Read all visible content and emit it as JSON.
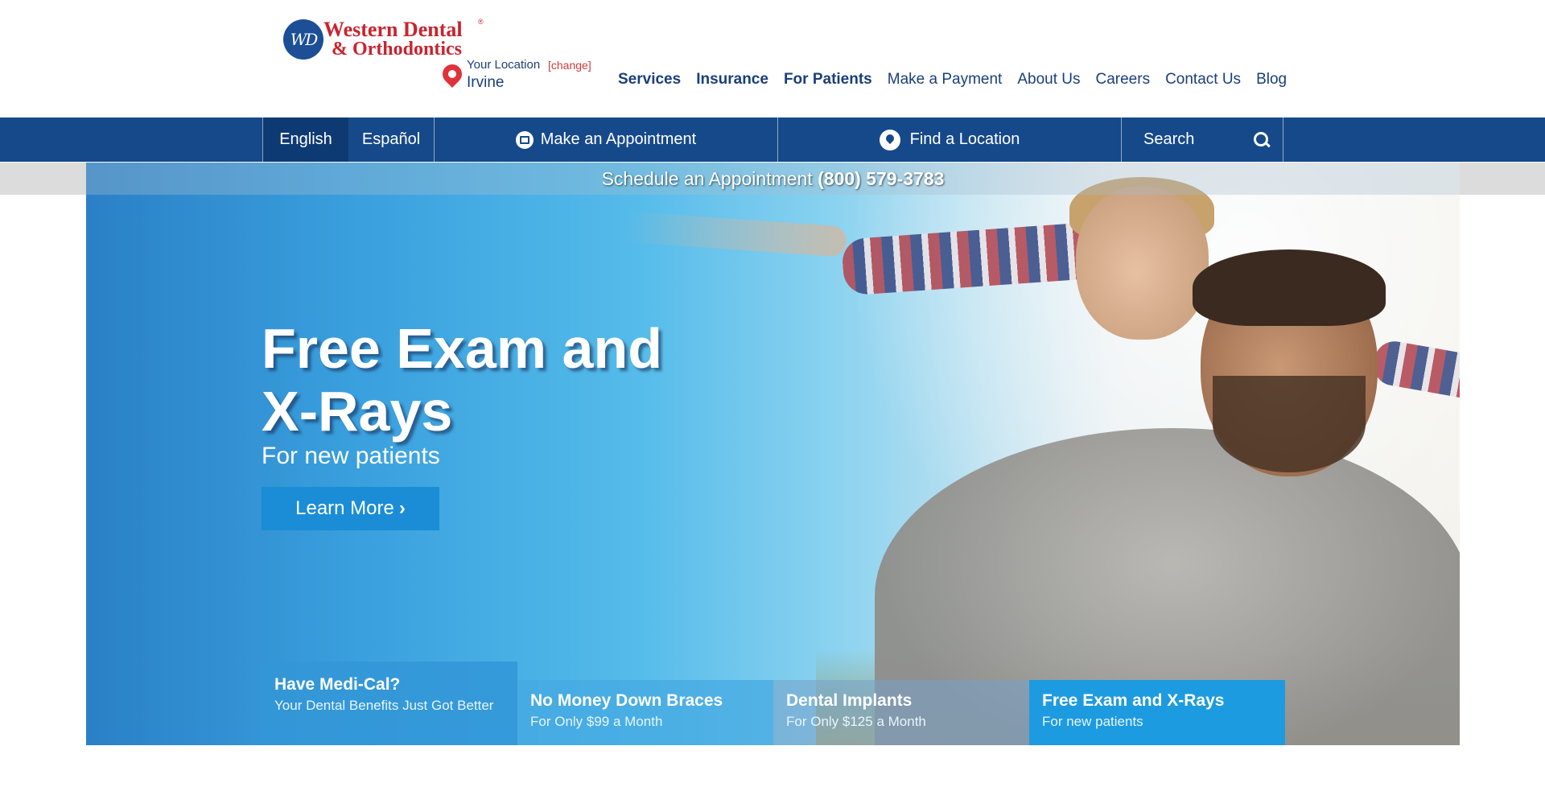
{
  "logo": {
    "monogram": "WD",
    "line1": "Western Dental",
    "line2": "& Orthodontics",
    "registered": "®"
  },
  "location": {
    "label": "Your Location",
    "change": "[change]",
    "city": "Irvine"
  },
  "nav": {
    "items": [
      "Services",
      "Insurance",
      "For Patients",
      "Make a Payment",
      "About Us",
      "Careers",
      "Contact Us",
      "Blog"
    ]
  },
  "toolbar": {
    "english": "English",
    "espanol": "Español",
    "appointment": "Make an Appointment",
    "find_location": "Find a Location",
    "search": "Search"
  },
  "schedule": {
    "text": "Schedule an Appointment",
    "phone": "(800) 579-3783"
  },
  "hero": {
    "title": "Free Exam and X-Rays",
    "subtitle": "For new patients",
    "cta": "Learn More"
  },
  "tabs": [
    {
      "title": "Have Medi-Cal?",
      "desc": "Your Dental Benefits Just Got Better"
    },
    {
      "title": "No Money Down Braces",
      "desc": "For Only $99 a Month"
    },
    {
      "title": "Dental Implants",
      "desc": "For Only $125 a Month"
    },
    {
      "title": "Free Exam and X-Rays",
      "desc": "For new patients"
    }
  ],
  "colors": {
    "brand_red": "#c8242f",
    "brand_blue": "#16498a",
    "cta_blue": "#1a8dd6"
  },
  "icons": {
    "calendar": "calendar-icon",
    "pin": "map-pin-icon",
    "search": "search-icon",
    "chevron": "chevron-right-icon"
  }
}
